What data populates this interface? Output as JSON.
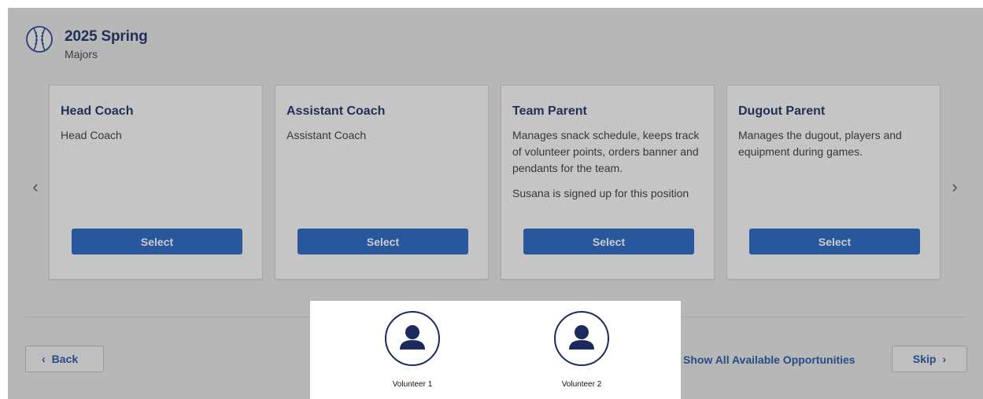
{
  "season": {
    "title": "2025 Spring",
    "division": "Majors",
    "icon": "baseball-icon"
  },
  "carousel": {
    "prev_icon": "chevron-left-icon",
    "next_icon": "chevron-right-icon",
    "prev_glyph": "‹",
    "next_glyph": "›"
  },
  "cards": [
    {
      "title": "Head Coach",
      "description": "Head Coach",
      "note": "",
      "button": "Select"
    },
    {
      "title": "Assistant Coach",
      "description": "Assistant Coach",
      "note": "",
      "button": "Select"
    },
    {
      "title": "Team Parent",
      "description": "Manages snack schedule, keeps track of volunteer points, orders banner and pendants for the team.",
      "note": "Susana is signed up for this position",
      "button": "Select"
    },
    {
      "title": "Dugout Parent",
      "description": "Manages the dugout, players and equipment during games.",
      "note": "",
      "button": "Select"
    }
  ],
  "footer": {
    "back_label": "Back",
    "back_glyph": "‹",
    "show_all_label": "Show All Available Opportunities",
    "skip_label": "Skip",
    "skip_glyph": "›"
  },
  "volunteers": [
    {
      "label": "Volunteer 1",
      "icon": "person-icon"
    },
    {
      "label": "Volunteer 2",
      "icon": "person-icon"
    }
  ],
  "colors": {
    "primary": "#1e5fbf",
    "title": "#0f2a5e",
    "link": "#1a4fa3"
  }
}
